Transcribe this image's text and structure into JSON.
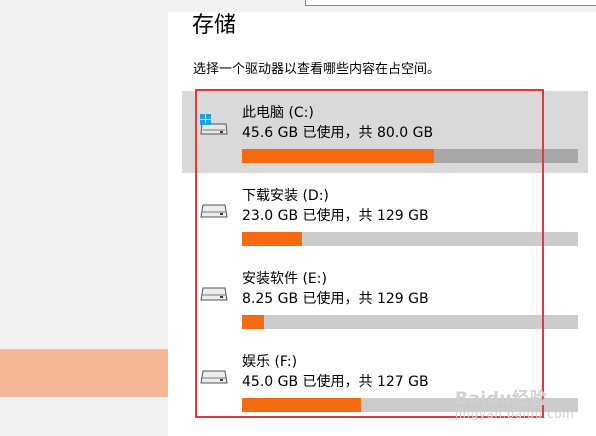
{
  "page": {
    "title": "存储",
    "subtitle": "选择一个驱动器以查看哪些内容在占空间。"
  },
  "drives": [
    {
      "name": "此电脑 (C:)",
      "usage": "45.6 GB 已使用，共 80.0 GB",
      "used_fraction": 0.57,
      "selected": true,
      "icon": "system-drive-icon"
    },
    {
      "name": "下载安装 (D:)",
      "usage": "23.0 GB 已使用，共 129 GB",
      "used_fraction": 0.178,
      "selected": false,
      "icon": "drive-icon"
    },
    {
      "name": "安装软件 (E:)",
      "usage": "8.25 GB 已使用，共 129 GB",
      "used_fraction": 0.064,
      "selected": false,
      "icon": "drive-icon"
    },
    {
      "name": "娱乐 (F:)",
      "usage": "45.0 GB 已使用，共 127 GB",
      "used_fraction": 0.354,
      "selected": false,
      "icon": "drive-icon"
    }
  ],
  "watermark": {
    "text": "Baidu经验",
    "sub": "jingyan.baidu.com"
  },
  "colors": {
    "bar_fill": "#f56a11",
    "bar_track": "#cccccc",
    "selected_bg": "#d9d9d9",
    "sidebar_highlight": "#f4b896",
    "annotation": "#e03b3b"
  }
}
